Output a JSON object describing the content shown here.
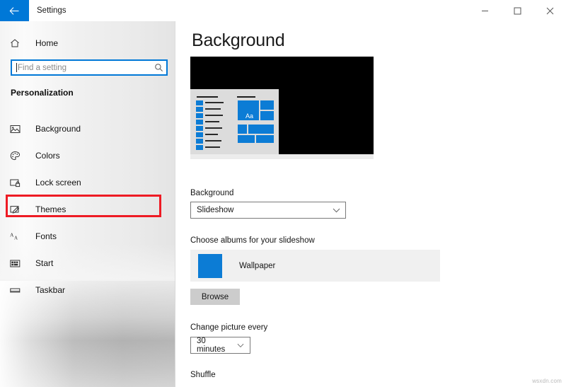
{
  "window": {
    "title": "Settings",
    "back_icon": "back-arrow-icon",
    "minimize_label": "Minimize",
    "maximize_label": "Maximize",
    "close_label": "Close"
  },
  "sidebar": {
    "home_label": "Home",
    "home_icon": "home-icon",
    "search": {
      "placeholder": "Find a setting",
      "value": "",
      "icon": "search-icon"
    },
    "section_title": "Personalization",
    "items": [
      {
        "label": "Background",
        "icon": "picture-icon",
        "selected": false
      },
      {
        "label": "Colors",
        "icon": "palette-icon",
        "selected": false
      },
      {
        "label": "Lock screen",
        "icon": "lock-screen-icon",
        "selected": false
      },
      {
        "label": "Themes",
        "icon": "themes-brush-icon",
        "selected": false
      },
      {
        "label": "Fonts",
        "icon": "fonts-aa-icon",
        "selected": false
      },
      {
        "label": "Start",
        "icon": "start-grid-icon",
        "selected": false
      },
      {
        "label": "Taskbar",
        "icon": "taskbar-icon",
        "selected": false
      }
    ],
    "annotation": {
      "target": "Themes",
      "color": "#ee1b24"
    }
  },
  "main": {
    "page_title": "Background",
    "preview": {
      "name": "background-preview",
      "tile_text": "Aa",
      "desktop_color": "#000000",
      "start_menu_color": "#dcdcdc",
      "accent_color": "#0c7cd5"
    },
    "background_label": "Background",
    "background_value": "Slideshow",
    "albums_label": "Choose albums for your slideshow",
    "album_name": "Wallpaper",
    "browse_label": "Browse",
    "change_picture_label": "Change picture every",
    "change_picture_value": "30 minutes",
    "shuffle_label": "Shuffle"
  },
  "watermark": "wsxdn.com"
}
